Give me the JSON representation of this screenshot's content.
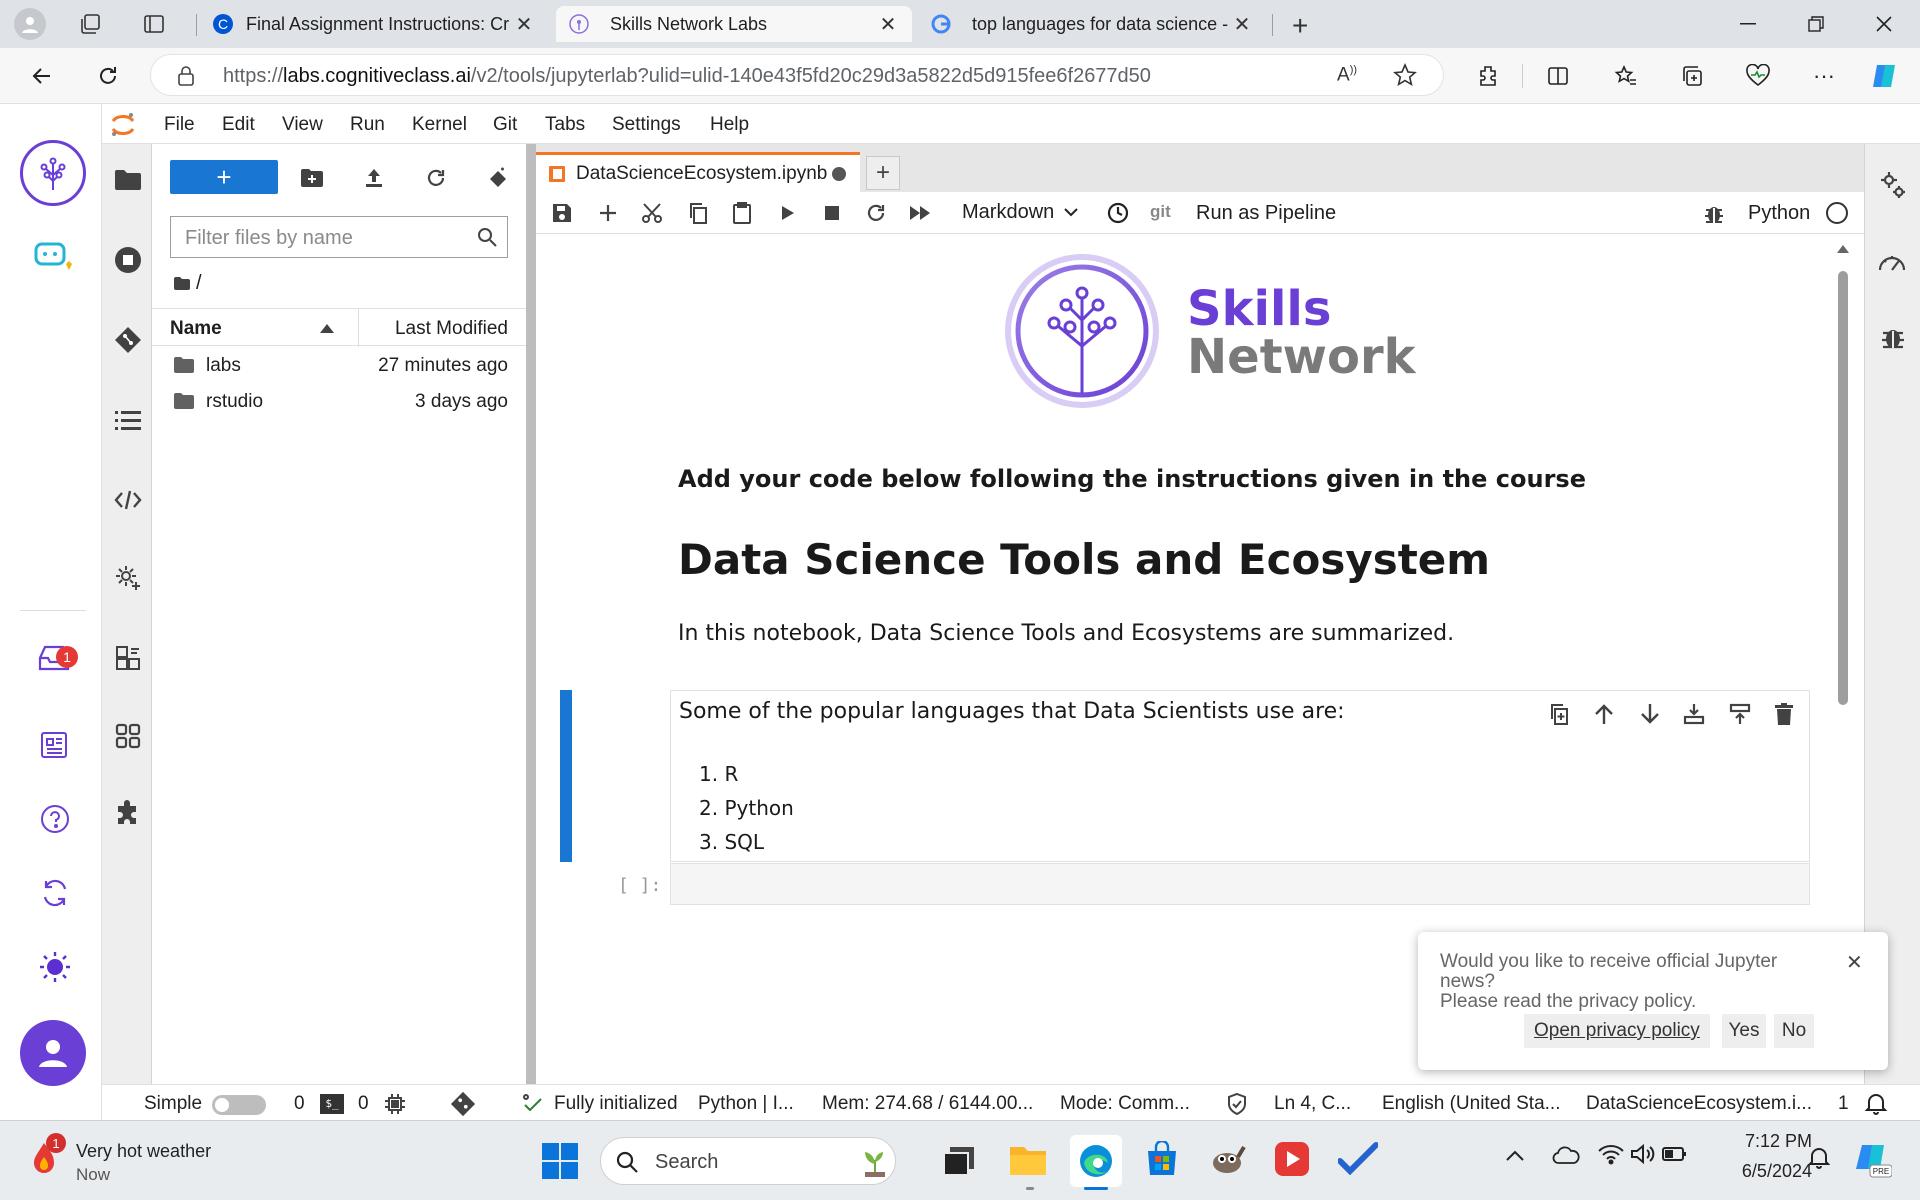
{
  "browser": {
    "tabs": [
      {
        "title": "Final Assignment Instructions: Cr",
        "active": false
      },
      {
        "title": "Skills Network Labs",
        "active": true
      },
      {
        "title": "top languages for data science -",
        "active": false
      }
    ],
    "url_prefix": "https://",
    "url_host": "labs.cognitiveclass.ai",
    "url_path": "/v2/tools/jupyterlab?ulid=ulid-140e43f5fd20c29d3a5822d5d915fee6f2677d50"
  },
  "menu": [
    "File",
    "Edit",
    "View",
    "Run",
    "Kernel",
    "Git",
    "Tabs",
    "Settings",
    "Help"
  ],
  "filebrowser": {
    "new_label": "+",
    "filter_placeholder": "Filter files by name",
    "path": "/",
    "col_name": "Name",
    "col_modified": "Last Modified",
    "items": [
      {
        "name": "labs",
        "modified": "27 minutes ago"
      },
      {
        "name": "rstudio",
        "modified": "3 days ago"
      }
    ]
  },
  "notebook": {
    "tab_title": "DataScienceEcosystem.ipynb",
    "cell_type": "Markdown",
    "git_label": "git",
    "run_pipeline": "Run as Pipeline",
    "kernel": "Python",
    "logo_line1": "Skills",
    "logo_line2": "Network",
    "instruction": "Add your code below following the instructions given in the course",
    "heading": "Data Science Tools and Ecosystem",
    "intro": "In this notebook, Data Science Tools and Ecosystems are summarized.",
    "languages_intro": "Some of the popular languages that Data Scientists use are:",
    "languages": [
      "R",
      "Python",
      "SQL"
    ],
    "code_prompt": "[ ]:"
  },
  "news_popup": {
    "line1": "Would you like to receive official Jupyter",
    "line2": "news?",
    "line3": "Please read the privacy policy.",
    "privacy_btn": "Open privacy policy",
    "yes": "Yes",
    "no": "No"
  },
  "statusbar": {
    "mode_simple": "Simple",
    "terminals": "0",
    "kernels": "0",
    "init": "Fully initialized",
    "kernel_info": "Python | I...",
    "mem": "Mem: 274.68 / 6144.00...",
    "mode": "Mode: Comm...",
    "cursor": "Ln 4, C...",
    "lang": "English (United Sta...",
    "file": "DataScienceEcosystem.i...",
    "notif_count": "1"
  },
  "rail_badge": "1",
  "taskbar": {
    "weather_title": "Very hot weather",
    "weather_sub": "Now",
    "weather_badge": "1",
    "search": "Search",
    "time": "7:12 PM",
    "date": "6/5/2024"
  },
  "colors": {
    "jupyter_orange": "#f37626",
    "accent_blue": "#1976d2",
    "sn_purple": "#6a3fd6"
  }
}
